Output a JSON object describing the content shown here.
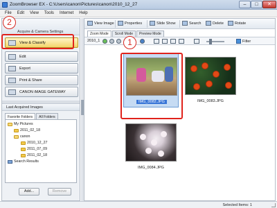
{
  "window": {
    "title": "ZoomBrowser EX  -  C:\\Users\\canon\\Pictures\\canon\\2010_12_27",
    "minimize": "–",
    "maximize": "□",
    "close": "✕"
  },
  "menu": [
    "File",
    "Edit",
    "View",
    "Tools",
    "Internet",
    "Help"
  ],
  "tasks": {
    "header": "Acquire & Camera Settings",
    "buttons": [
      {
        "label": "View & Classify",
        "icon": "view-classify-icon",
        "selected": true
      },
      {
        "label": "Edit",
        "icon": "edit-icon",
        "selected": false
      },
      {
        "label": "Export",
        "icon": "export-icon",
        "selected": false
      },
      {
        "label": "Print & Share",
        "icon": "printer-icon",
        "selected": false
      },
      {
        "label": "CANON iMAGE GATEWAY",
        "icon": "globe-icon",
        "selected": false
      }
    ]
  },
  "last_acquired": {
    "header": "Last Acquired Images",
    "tabs": [
      "Favorite Folders",
      "All Folders"
    ],
    "tree": [
      "My Pictures",
      "2011_02_18",
      "canon",
      "2010_12_27",
      "2011_07_09",
      "2011_02_18",
      "Search Results"
    ],
    "add_label": "Add...",
    "remove_label": "Remove"
  },
  "toolbar": {
    "view_image": "View Image",
    "properties": "Properties",
    "slide_show": "Slide Show",
    "search": "Search",
    "delete": "Delete",
    "rotate": "Rotate"
  },
  "modes": [
    "Zoom Mode",
    "Scroll Mode",
    "Preview Mode"
  ],
  "nav": {
    "path": "2010_1",
    "filter": "Filter"
  },
  "thumbnails": [
    {
      "caption": "IMG_0082.JPG",
      "selected": true
    },
    {
      "caption": "IMG_0083.JPG",
      "selected": false
    },
    {
      "caption": "IMG_0084.JPG",
      "selected": false
    }
  ],
  "callouts": {
    "one": "1",
    "two": "2"
  },
  "status": {
    "selected": "Selected Items: 1"
  },
  "colors": {
    "accent": "#e0221b",
    "selection": "#3875d7"
  }
}
